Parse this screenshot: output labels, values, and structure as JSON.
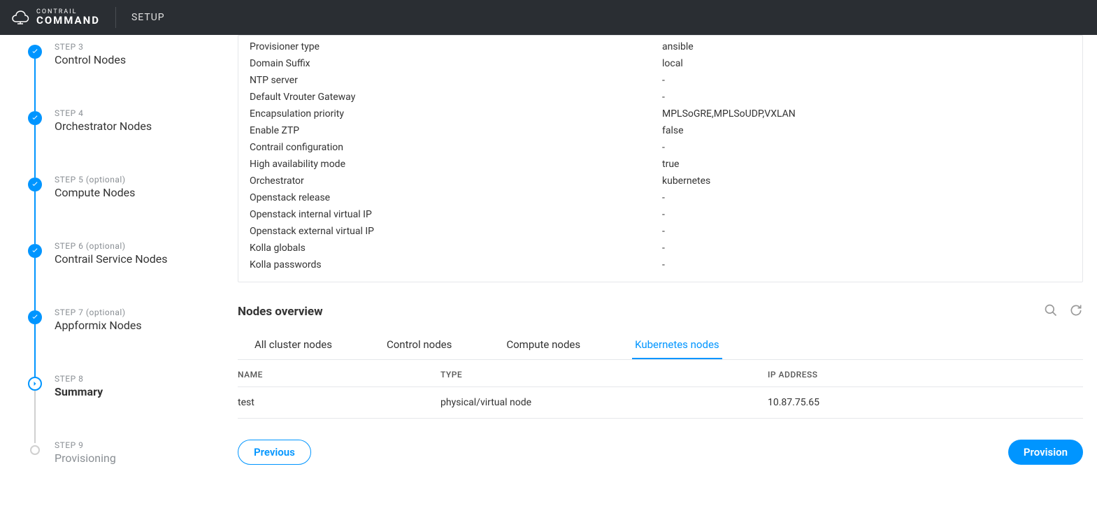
{
  "header": {
    "brand_top": "CONTRAIL",
    "brand_bottom": "COMMAND",
    "page": "SETUP"
  },
  "steps": [
    {
      "num": "STEP 3",
      "title": "Control Nodes",
      "state": "done"
    },
    {
      "num": "STEP 4",
      "title": "Orchestrator Nodes",
      "state": "done"
    },
    {
      "num": "STEP 5 (optional)",
      "title": "Compute Nodes",
      "state": "done"
    },
    {
      "num": "STEP 6 (optional)",
      "title": "Contrail Service Nodes",
      "state": "done"
    },
    {
      "num": "STEP 7 (optional)",
      "title": "Appformix Nodes",
      "state": "done"
    },
    {
      "num": "STEP 8",
      "title": "Summary",
      "state": "current"
    },
    {
      "num": "STEP 9",
      "title": "Provisioning",
      "state": "pending"
    }
  ],
  "config": [
    {
      "label": "Provisioner type",
      "value": "ansible"
    },
    {
      "label": "Domain Suffix",
      "value": "local"
    },
    {
      "label": "NTP server",
      "value": "-"
    },
    {
      "label": "Default Vrouter Gateway",
      "value": "-"
    },
    {
      "label": "Encapsulation priority",
      "value": "MPLSoGRE,MPLSoUDP,VXLAN"
    },
    {
      "label": "Enable ZTP",
      "value": "false"
    },
    {
      "label": "Contrail configuration",
      "value": "-"
    },
    {
      "label": "High availability mode",
      "value": "true"
    },
    {
      "label": "Orchestrator",
      "value": "kubernetes"
    },
    {
      "label": "Openstack release",
      "value": "-"
    },
    {
      "label": "Openstack internal virtual IP",
      "value": "-"
    },
    {
      "label": "Openstack external virtual IP",
      "value": "-"
    },
    {
      "label": "Kolla globals",
      "value": "-"
    },
    {
      "label": "Kolla passwords",
      "value": "-"
    }
  ],
  "nodes_section": {
    "title": "Nodes overview"
  },
  "tabs": [
    "All cluster nodes",
    "Control nodes",
    "Compute nodes",
    "Kubernetes nodes"
  ],
  "active_tab": 3,
  "table": {
    "columns": [
      "NAME",
      "TYPE",
      "IP ADDRESS"
    ],
    "rows": [
      {
        "name": "test",
        "type": "physical/virtual node",
        "ip": "10.87.75.65"
      }
    ]
  },
  "buttons": {
    "prev": "Previous",
    "provision": "Provision"
  }
}
